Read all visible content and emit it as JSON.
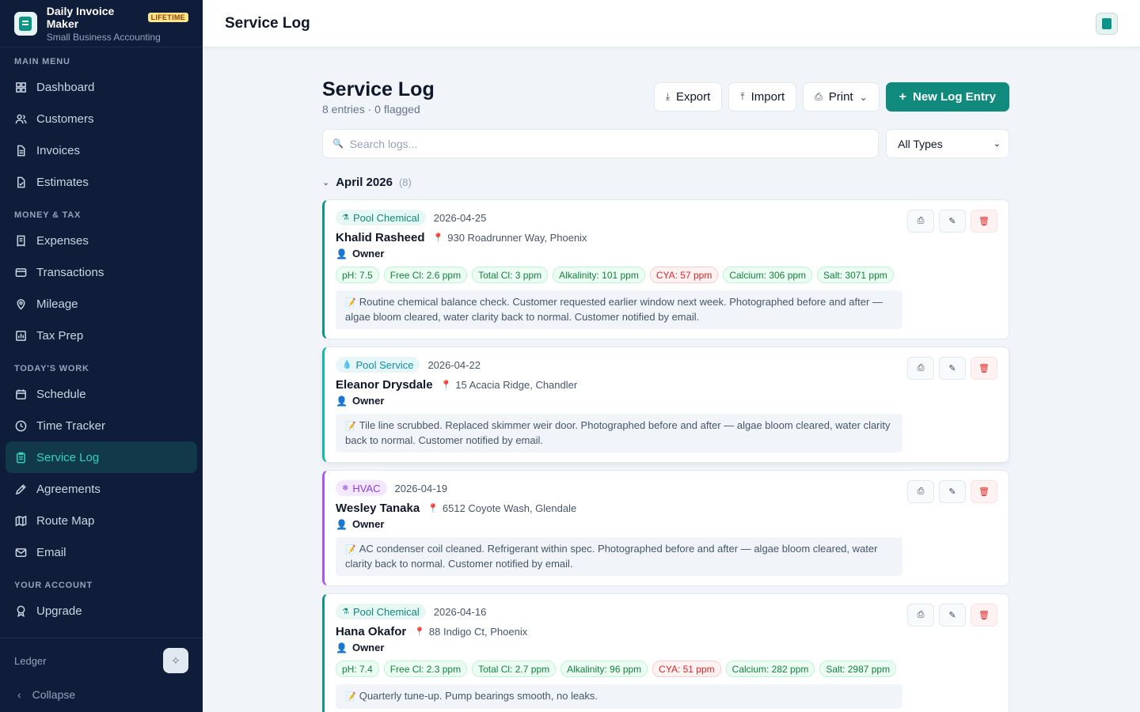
{
  "brand": {
    "title": "Daily Invoice Maker",
    "badge": "LIFETIME",
    "subtitle": "Small Business Accounting"
  },
  "sidebar": {
    "sections": [
      {
        "label": "MAIN MENU",
        "items": [
          {
            "label": "Dashboard",
            "icon": "grid-icon"
          },
          {
            "label": "Customers",
            "icon": "users-icon"
          },
          {
            "label": "Invoices",
            "icon": "file-icon"
          },
          {
            "label": "Estimates",
            "icon": "file-check-icon"
          }
        ]
      },
      {
        "label": "MONEY & TAX",
        "items": [
          {
            "label": "Expenses",
            "icon": "receipt-icon"
          },
          {
            "label": "Transactions",
            "icon": "credit-card-icon"
          },
          {
            "label": "Mileage",
            "icon": "map-pin-icon"
          },
          {
            "label": "Tax Prep",
            "icon": "bar-chart-icon"
          }
        ]
      },
      {
        "label": "TODAY'S WORK",
        "items": [
          {
            "label": "Schedule",
            "icon": "calendar-icon"
          },
          {
            "label": "Time Tracker",
            "icon": "clock-icon"
          },
          {
            "label": "Service Log",
            "icon": "clipboard-icon",
            "active": true
          },
          {
            "label": "Agreements",
            "icon": "pen-icon"
          },
          {
            "label": "Route Map",
            "icon": "map-icon"
          },
          {
            "label": "Email",
            "icon": "mail-icon"
          }
        ]
      },
      {
        "label": "YOUR ACCOUNT",
        "items": [
          {
            "label": "Upgrade",
            "icon": "award-icon"
          }
        ]
      }
    ],
    "footer": {
      "ledger_label": "Ledger",
      "collapse_label": "Collapse"
    }
  },
  "topbar": {
    "title": "Service Log"
  },
  "page": {
    "title": "Service Log",
    "subtitle": "8 entries · 0 flagged",
    "actions": {
      "export": "Export",
      "import": "Import",
      "print": "Print",
      "new_entry": "New Log Entry"
    },
    "search": {
      "placeholder": "Search logs...",
      "value": ""
    },
    "type_filter": {
      "selected": "All Types"
    },
    "group": {
      "title": "April 2026",
      "count": "(8)"
    }
  },
  "entries": [
    {
      "type": "Pool Chemical",
      "date": "2026-04-25",
      "customer": "Khalid Rasheed",
      "address": "930 Roadrunner Way, Phoenix",
      "role": "Owner",
      "readings": [
        {
          "label": "pH: 7.5",
          "status": "ok"
        },
        {
          "label": "Free Cl: 2.6 ppm",
          "status": "ok"
        },
        {
          "label": "Total Cl: 3 ppm",
          "status": "ok"
        },
        {
          "label": "Alkalinity: 101 ppm",
          "status": "ok"
        },
        {
          "label": "CYA: 57 ppm",
          "status": "bad"
        },
        {
          "label": "Calcium: 306 ppm",
          "status": "ok"
        },
        {
          "label": "Salt: 3071 ppm",
          "status": "ok"
        }
      ],
      "note": "Routine chemical balance check. Customer requested earlier window next week. Photographed before and after — algae bloom cleared, water clarity back to normal. Customer notified by email."
    },
    {
      "type": "Pool Service",
      "date": "2026-04-22",
      "customer": "Eleanor Drysdale",
      "address": "15 Acacia Ridge, Chandler",
      "role": "Owner",
      "readings": [],
      "note": "Tile line scrubbed. Replaced skimmer weir door. Photographed before and after — algae bloom cleared, water clarity back to normal. Customer notified by email."
    },
    {
      "type": "HVAC",
      "date": "2026-04-19",
      "customer": "Wesley Tanaka",
      "address": "6512 Coyote Wash, Glendale",
      "role": "Owner",
      "readings": [],
      "note": "AC condenser coil cleaned. Refrigerant within spec. Photographed before and after — algae bloom cleared, water clarity back to normal. Customer notified by email."
    },
    {
      "type": "Pool Chemical",
      "date": "2026-04-16",
      "customer": "Hana Okafor",
      "address": "88 Indigo Ct, Phoenix",
      "role": "Owner",
      "readings": [
        {
          "label": "pH: 7.4",
          "status": "ok"
        },
        {
          "label": "Free Cl: 2.3 ppm",
          "status": "ok"
        },
        {
          "label": "Total Cl: 2.7 ppm",
          "status": "ok"
        },
        {
          "label": "Alkalinity: 96 ppm",
          "status": "ok"
        },
        {
          "label": "CYA: 51 ppm",
          "status": "bad"
        },
        {
          "label": "Calcium: 282 ppm",
          "status": "ok"
        },
        {
          "label": "Salt: 2987 ppm",
          "status": "ok"
        }
      ],
      "note": "Quarterly tune-up. Pump bearings smooth, no leaks."
    }
  ],
  "colors": {
    "sidebar_bg": "#0f1d3a",
    "accent": "#0f8a7c",
    "active_text": "#2dd4bf",
    "danger": "#dc2626",
    "hvac": "#a855f7"
  }
}
